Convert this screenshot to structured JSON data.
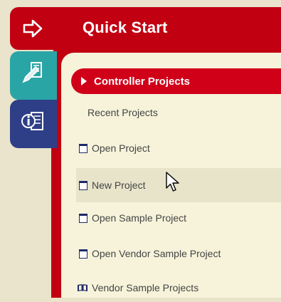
{
  "header": {
    "title": "Quick Start"
  },
  "tabs": [
    {
      "name": "quick-start-tab",
      "icon": "arrow-right-icon",
      "color": "#c10012"
    },
    {
      "name": "tools-tab",
      "icon": "pencil-ruler-icon",
      "color": "#2aa5a6"
    },
    {
      "name": "info-tab",
      "icon": "info-doc-icon",
      "color": "#2e3f88"
    }
  ],
  "menu": {
    "controller_projects": "Controller Projects",
    "recent_projects": "Recent Projects",
    "items": [
      {
        "label": "Open Project",
        "icon": "window-icon"
      },
      {
        "label": "New Project",
        "icon": "window-icon"
      },
      {
        "label": "Open Sample Project",
        "icon": "window-icon"
      },
      {
        "label": "Open Vendor Sample Project",
        "icon": "window-icon"
      },
      {
        "label": "Vendor Sample Projects",
        "icon": "book-icon"
      }
    ]
  },
  "colors": {
    "accent_red": "#c10012",
    "teal": "#2aa5a6",
    "navy": "#2e3f88",
    "panel": "#f6f3da"
  }
}
